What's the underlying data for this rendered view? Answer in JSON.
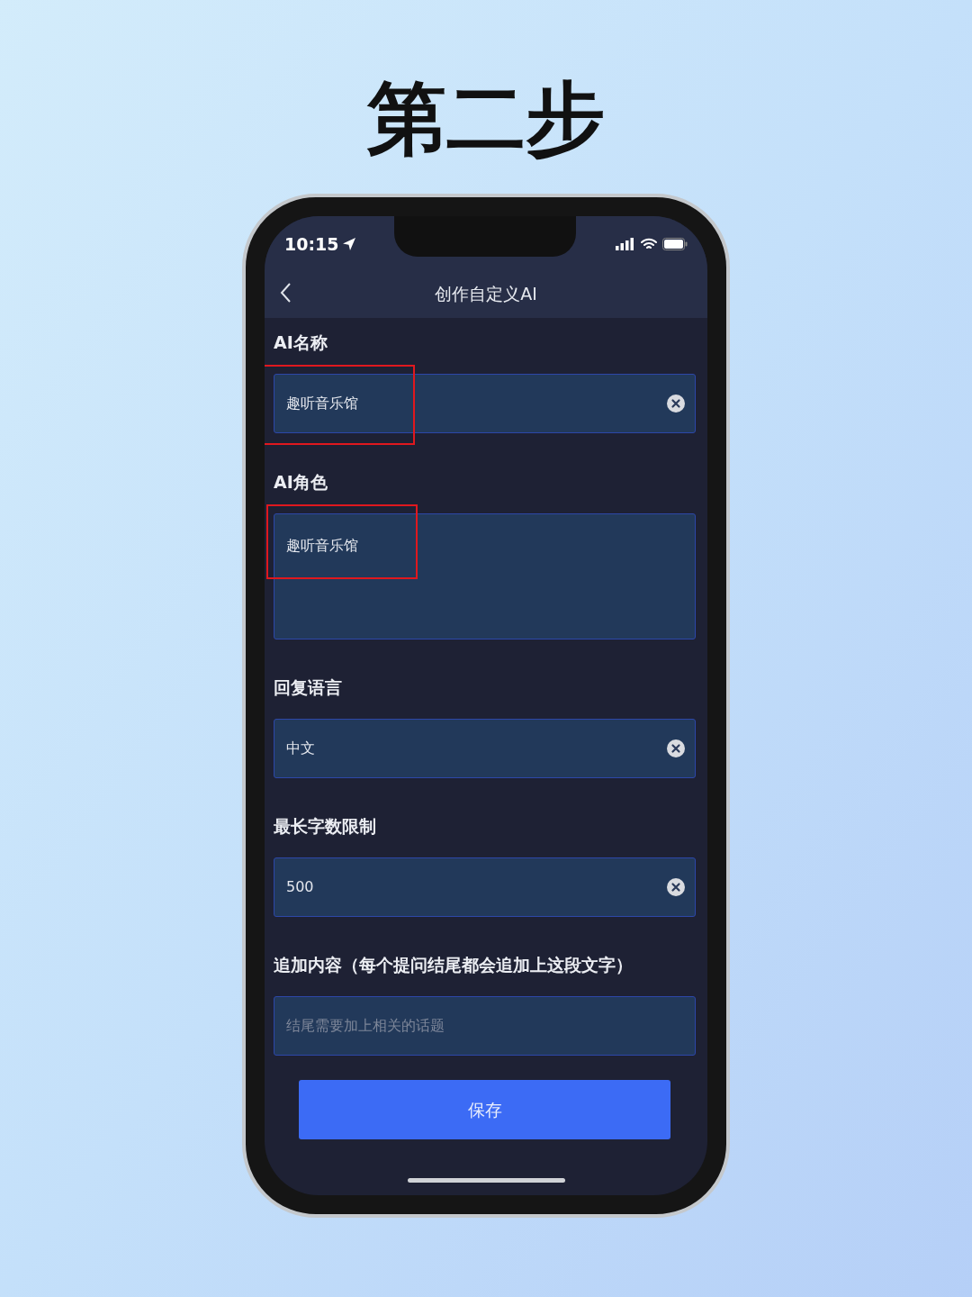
{
  "heading": "第二步",
  "status_bar": {
    "time": "10:15"
  },
  "nav": {
    "title": "创作自定义AI"
  },
  "fields": [
    {
      "label": "AI名称",
      "kind": "input",
      "value": "趣听音乐馆",
      "clearable": true,
      "highlighted": true
    },
    {
      "label": "AI角色",
      "kind": "textarea",
      "value": "趣听音乐馆",
      "clearable": false,
      "highlighted": true
    },
    {
      "label": "回复语言",
      "kind": "input",
      "value": "中文",
      "clearable": true,
      "highlighted": false
    },
    {
      "label": "最长字数限制",
      "kind": "input",
      "value": "500",
      "clearable": true,
      "highlighted": false
    },
    {
      "label": "追加内容（每个提问结尾都会追加上这段文字）",
      "kind": "input",
      "placeholder": "结尾需要加上相关的话题",
      "clearable": false,
      "highlighted": false
    }
  ],
  "save_button": "保存"
}
